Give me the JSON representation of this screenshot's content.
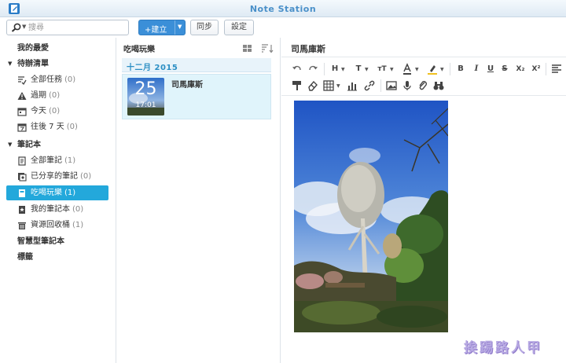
{
  "app": {
    "title": "Note Station"
  },
  "toolbar": {
    "search_placeholder": "搜尋",
    "new_label": "建立",
    "sync_label": "同步",
    "settings_label": "設定"
  },
  "sidebar": {
    "favorites": "我的最愛",
    "todo": {
      "label": "待辦清單",
      "items": [
        {
          "label": "全部任務",
          "count": "(0)"
        },
        {
          "label": "過期",
          "count": "(0)"
        },
        {
          "label": "今天",
          "count": "(0)"
        },
        {
          "label": "往後 7 天",
          "count": "(0)"
        }
      ]
    },
    "notebook": {
      "label": "筆記本",
      "items": [
        {
          "label": "全部筆記",
          "count": "(1)"
        },
        {
          "label": "已分享的筆記",
          "count": "(0)"
        },
        {
          "label": "吃喝玩樂",
          "count": "(1)"
        },
        {
          "label": "我的筆記本",
          "count": "(0)"
        },
        {
          "label": "資源回收桶",
          "count": "(1)"
        }
      ]
    },
    "smart_notebook": "智慧型筆記本",
    "tags": "標籤"
  },
  "notelist": {
    "title": "吃喝玩樂",
    "group": "十二月 2015",
    "note": {
      "title": "司馬庫斯",
      "day": "25",
      "time": "17:01"
    }
  },
  "editor": {
    "title": "司馬庫斯"
  },
  "watermark": "挨踢路人甲",
  "colors": {
    "accent": "#23a8db",
    "primary_button": "#3b8fd8",
    "group_header": "#2c8fc4"
  }
}
